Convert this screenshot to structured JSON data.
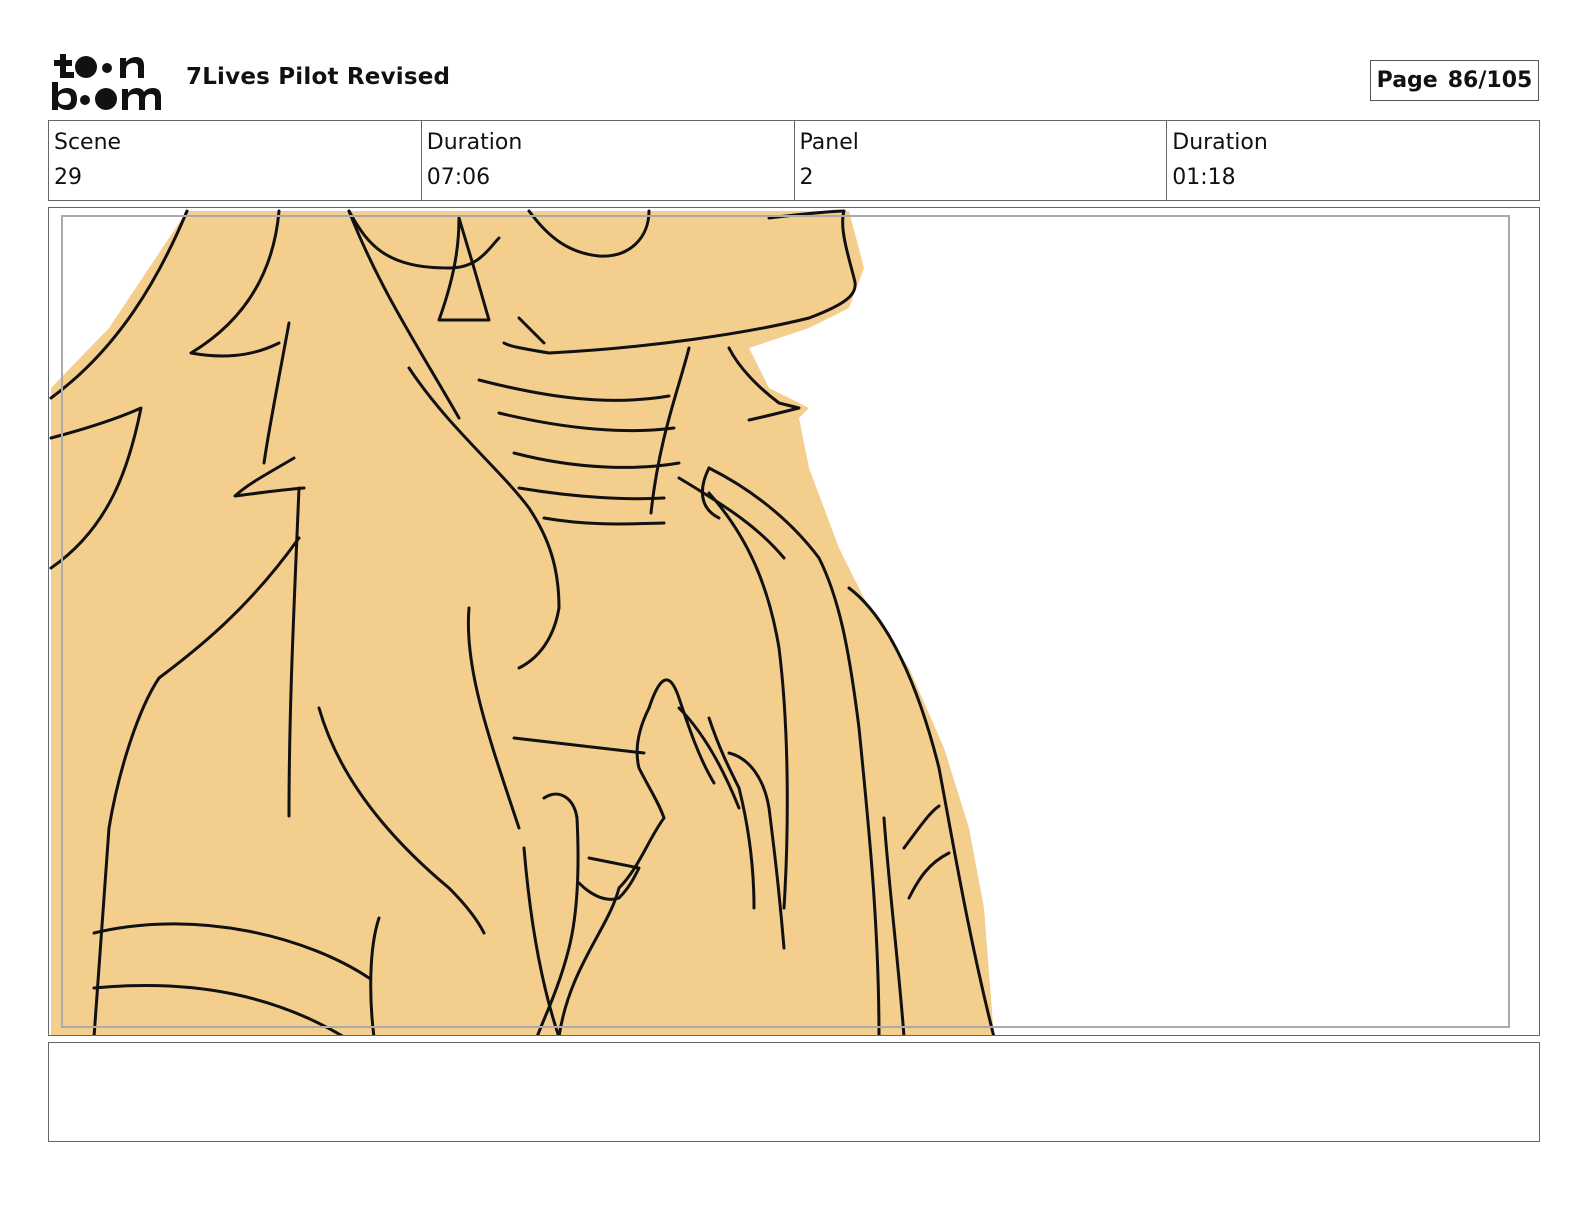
{
  "header": {
    "logo_label": "toon boom",
    "project_title": "7Lives Pilot Revised",
    "page_label": "Page",
    "page_value": "86/105"
  },
  "info": [
    {
      "label": "Scene",
      "value": "29"
    },
    {
      "label": "Duration",
      "value": "07:06"
    },
    {
      "label": "Panel",
      "value": "2"
    },
    {
      "label": "Duration",
      "value": "01:18"
    }
  ],
  "colors": {
    "fill": "#F4CE8C",
    "line": "#111111"
  },
  "notes": {
    "text": ""
  }
}
